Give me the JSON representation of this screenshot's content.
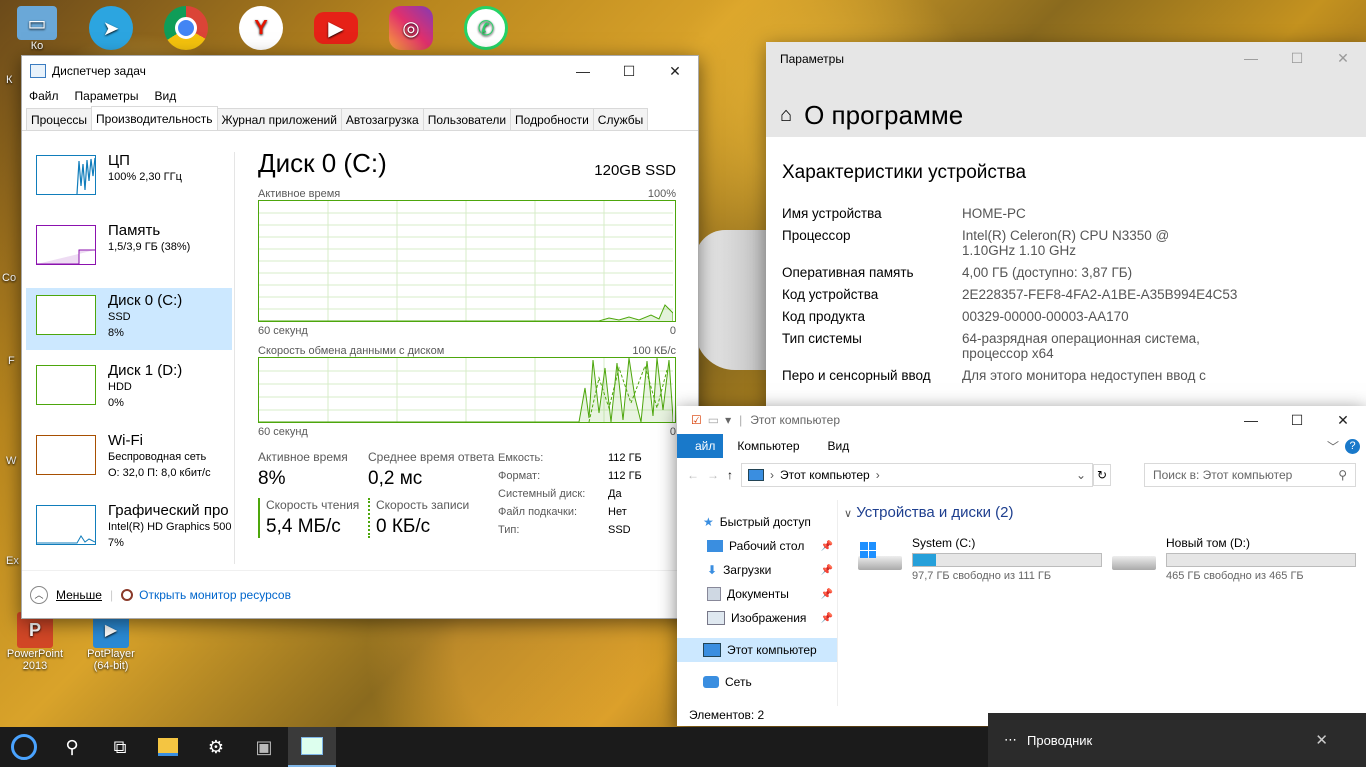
{
  "colors": {
    "disk_green": "#4da60c",
    "cpu_blue": "#117dbb",
    "mem_purple": "#8b12ae",
    "wifi_brown": "#a74f01",
    "accent": "#1979ca",
    "selected": "#cce8ff"
  },
  "desktop": {
    "icons": [
      {
        "label": "Ко",
        "name": "computer"
      },
      {
        "label": "",
        "name": "telegram"
      },
      {
        "label": "",
        "name": "chrome"
      },
      {
        "label": "",
        "name": "yandex"
      },
      {
        "label": "",
        "name": "youtube"
      },
      {
        "label": "",
        "name": "instagram"
      },
      {
        "label": "",
        "name": "whatsapp"
      }
    ],
    "bottom_icons": [
      {
        "label": "PowerPoint 2013",
        "name": "powerpoint"
      },
      {
        "label": "PotPlayer (64-bit)",
        "name": "potplayer"
      }
    ],
    "side_labels": [
      "К",
      "Co",
      "F",
      "W",
      "Ex"
    ]
  },
  "taskmgr": {
    "title": "Диспетчер задач",
    "menu": [
      "Файл",
      "Параметры",
      "Вид"
    ],
    "tabs": [
      "Процессы",
      "Производительность",
      "Журнал приложений",
      "Автозагрузка",
      "Пользователи",
      "Подробности",
      "Службы"
    ],
    "resources": [
      {
        "name": "ЦП",
        "sub1": "100% 2,30 ГГц",
        "sub2": "",
        "sub3": "",
        "color": "cpu_blue"
      },
      {
        "name": "Память",
        "sub1": "1,5/3,9 ГБ (38%)",
        "sub2": "",
        "sub3": "",
        "color": "mem_purple"
      },
      {
        "name": "Диск 0 (C:)",
        "sub1": "SSD",
        "sub2": "8%",
        "sub3": "",
        "color": "disk_green"
      },
      {
        "name": "Диск 1 (D:)",
        "sub1": "HDD",
        "sub2": "0%",
        "sub3": "",
        "color": "disk_green"
      },
      {
        "name": "Wi-Fi",
        "sub1": "Беспроводная сеть",
        "sub2": "О: 32,0 П: 8,0 кбит/с",
        "sub3": "",
        "color": "wifi_brown"
      },
      {
        "name": "Графический про",
        "sub1": "Intel(R) HD Graphics 500",
        "sub2": "7%",
        "sub3": "",
        "color": "cpu_blue"
      }
    ],
    "disk": {
      "title": "Диск 0 (C:)",
      "model": "120GB SSD",
      "graph1_label": "Активное время",
      "graph1_max": "100%",
      "graph1_time": "60 секунд",
      "graph1_min": "0",
      "graph2_label": "Скорость обмена данными с диском",
      "graph2_max": "100 КБ/с",
      "graph2_time": "60 секунд",
      "graph2_min": "0",
      "active_time_label": "Активное время",
      "active_time": "8%",
      "avg_response_label": "Среднее время ответа",
      "avg_response": "0,2 мс",
      "read_label": "Скорость чтения",
      "read": "5,4 МБ/с",
      "write_label": "Скорость записи",
      "write": "0 КБ/с",
      "props": [
        {
          "k": "Емкость:",
          "v": "112 ГБ"
        },
        {
          "k": "Формат:",
          "v": "112 ГБ"
        },
        {
          "k": "Системный диск:",
          "v": "Да"
        },
        {
          "k": "Файл подкачки:",
          "v": "Нет"
        },
        {
          "k": "Тип:",
          "v": "SSD"
        }
      ]
    },
    "footer": {
      "less": "Меньше",
      "monitor": "Открыть монитор ресурсов"
    }
  },
  "settings": {
    "title": "Параметры",
    "page_title": "О программе",
    "section": "Характеристики устройства",
    "specs": [
      {
        "k": "Имя устройства",
        "v": "HOME-PC"
      },
      {
        "k": "Процессор",
        "v": "Intel(R) Celeron(R) CPU N3350 @ 1.10GHz 1.10 GHz"
      },
      {
        "k": "Оперативная память",
        "v": "4,00 ГБ (доступно: 3,87 ГБ)"
      },
      {
        "k": "Код устройства",
        "v": "2E228357-FEF8-4FA2-A1BE-A35B994E4C53"
      },
      {
        "k": "Код продукта",
        "v": "00329-00000-00003-AA170"
      },
      {
        "k": "Тип системы",
        "v": "64-разрядная операционная система, процессор x64"
      },
      {
        "k": "Перо и сенсорный ввод",
        "v": "Для этого монитора недоступен ввод с"
      }
    ]
  },
  "explorer": {
    "title": "Этот компьютер",
    "ribbon": [
      "айл",
      "Компьютер",
      "Вид"
    ],
    "address": "Этот компьютер",
    "search_placeholder": "Поиск в: Этот компьютер",
    "nav": [
      {
        "label": "Быстрый доступ",
        "pin": false
      },
      {
        "label": "Рабочий стол",
        "pin": true
      },
      {
        "label": "Загрузки",
        "pin": true
      },
      {
        "label": "Документы",
        "pin": true
      },
      {
        "label": "Изображения",
        "pin": true
      },
      {
        "label": "Этот компьютер",
        "pin": false
      },
      {
        "label": "Сеть",
        "pin": false
      }
    ],
    "group": "Устройства и диски (2)",
    "drives": [
      {
        "name": "System (C:)",
        "free": "97,7 ГБ свободно из 111 ГБ",
        "used": 0.12
      },
      {
        "name": "Новый том (D:)",
        "free": "465 ГБ свободно из 465 ГБ",
        "used": 0.0
      }
    ],
    "status": "Элементов: 2"
  },
  "toast": {
    "text": "Проводник"
  }
}
